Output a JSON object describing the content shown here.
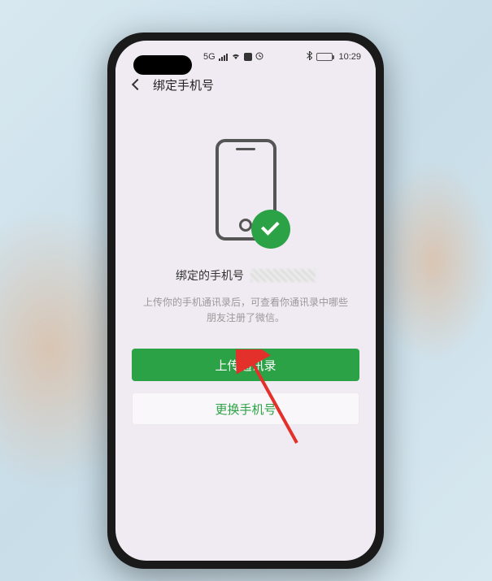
{
  "status_bar": {
    "carrier_5g": "5G",
    "time": "10:29"
  },
  "header": {
    "title": "绑定手机号"
  },
  "content": {
    "bound_phone_label": "绑定的手机号",
    "description": "上传你的手机通讯录后，可查看你通讯录中哪些朋友注册了微信。",
    "upload_button": "上传通讯录",
    "change_button": "更换手机号"
  }
}
